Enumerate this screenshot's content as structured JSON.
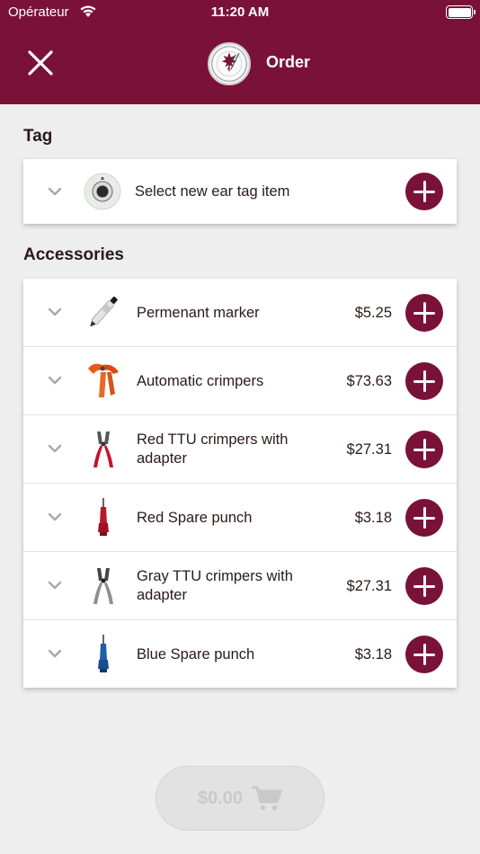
{
  "status_bar": {
    "carrier": "Opérateur",
    "time": "11:20 AM"
  },
  "header": {
    "title": "Order",
    "close_icon": "close-icon",
    "logo": "brand-logo"
  },
  "tag_section": {
    "label": "Tag",
    "item": {
      "name": "Select new ear tag item",
      "icon": "ear-tag-icon"
    }
  },
  "accessories_section": {
    "label": "Accessories",
    "items": [
      {
        "name": "Permenant marker",
        "price": "$5.25",
        "icon": "marker-icon"
      },
      {
        "name": "Automatic crimpers",
        "price": "$73.63",
        "icon": "automatic-crimpers-icon"
      },
      {
        "name": "Red TTU crimpers with adapter",
        "price": "$27.31",
        "icon": "red-crimpers-icon"
      },
      {
        "name": "Red Spare punch",
        "price": "$3.18",
        "icon": "red-punch-icon"
      },
      {
        "name": "Gray TTU crimpers with adapter",
        "price": "$27.31",
        "icon": "gray-crimpers-icon"
      },
      {
        "name": "Blue Spare punch",
        "price": "$3.18",
        "icon": "blue-punch-icon"
      }
    ]
  },
  "cart": {
    "total": "$0.00",
    "icon": "cart-icon"
  },
  "colors": {
    "brand": "#7a1238",
    "background": "#eeeeee",
    "disabled": "#c9c9c9"
  }
}
